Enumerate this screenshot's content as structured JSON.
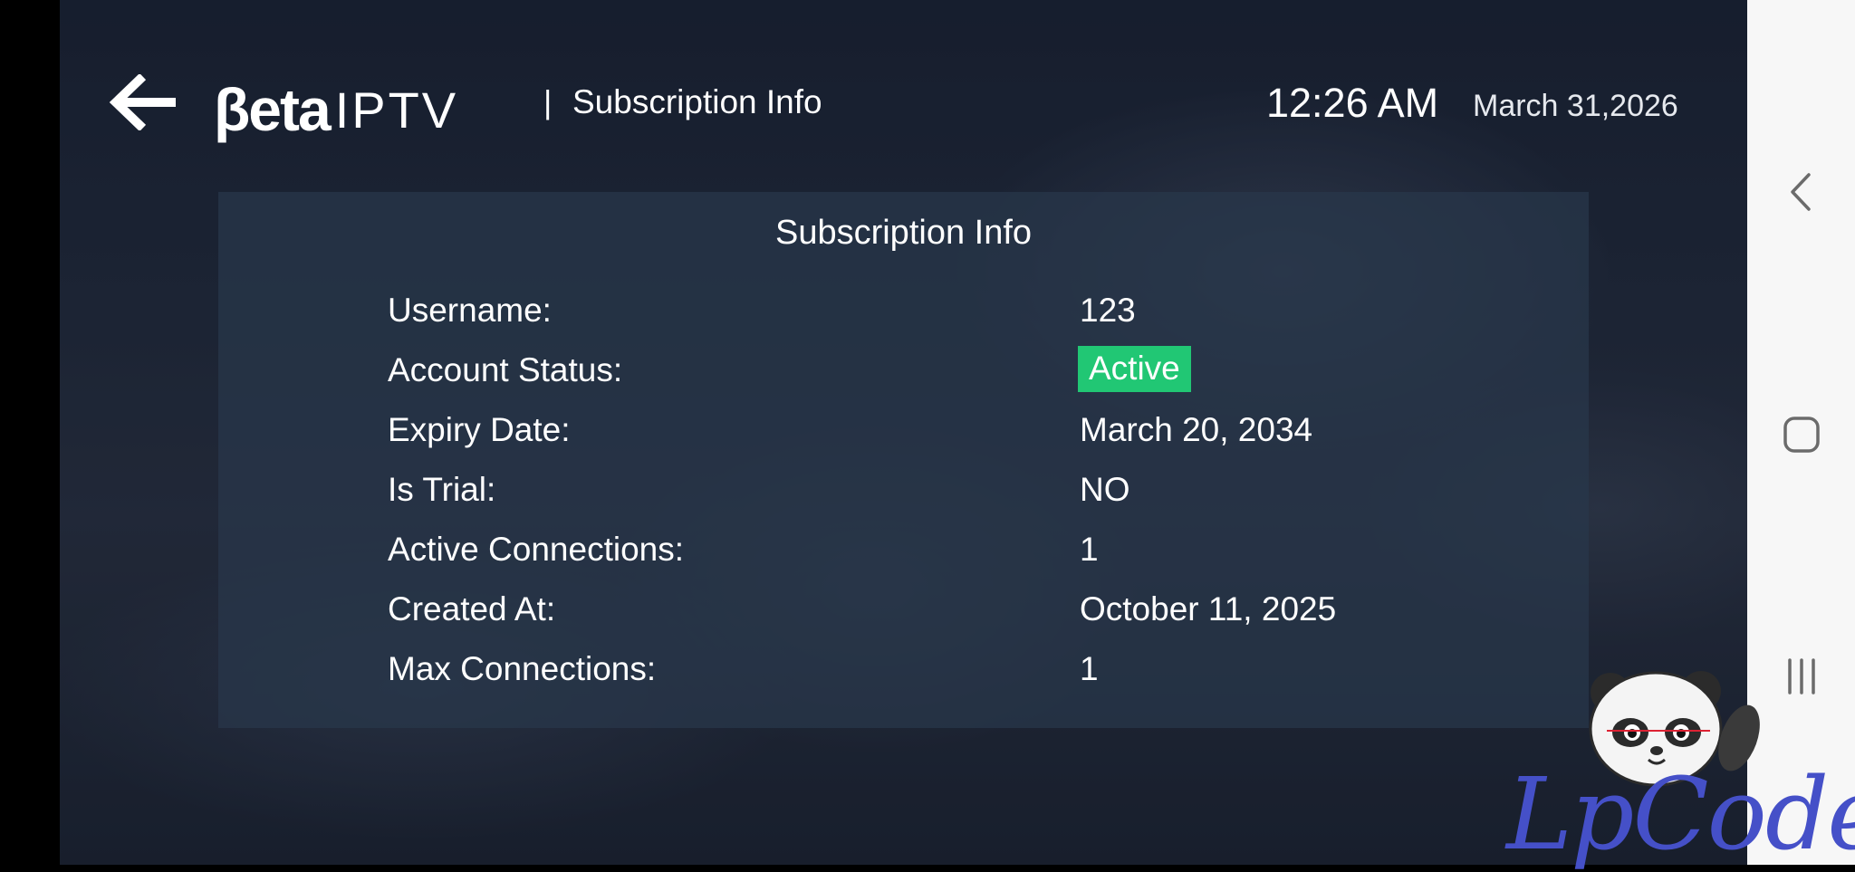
{
  "header": {
    "logo_beta": "βeta",
    "logo_iptv": "IPTV",
    "separator": "|",
    "title": "Subscription Info",
    "time": "12:26 AM",
    "date": "March 31,2026"
  },
  "panel": {
    "title": "Subscription Info",
    "rows": [
      {
        "label": "Username:",
        "value": "123"
      },
      {
        "label": "Account Status:",
        "value": "Active"
      },
      {
        "label": "Expiry Date:",
        "value": "March 20, 2034"
      },
      {
        "label": "Is Trial:",
        "value": "NO"
      },
      {
        "label": "Active Connections:",
        "value": "1"
      },
      {
        "label": "Created At:",
        "value": "October 11, 2025"
      },
      {
        "label": "Max Connections:",
        "value": "1"
      }
    ]
  },
  "status_color": "#21c774",
  "icons": {
    "back": "arrow-left-icon",
    "nav_back": "chevron-left-icon",
    "nav_home": "rounded-square-icon",
    "nav_recents": "three-lines-icon"
  },
  "watermark": {
    "text": "LpCodes"
  }
}
